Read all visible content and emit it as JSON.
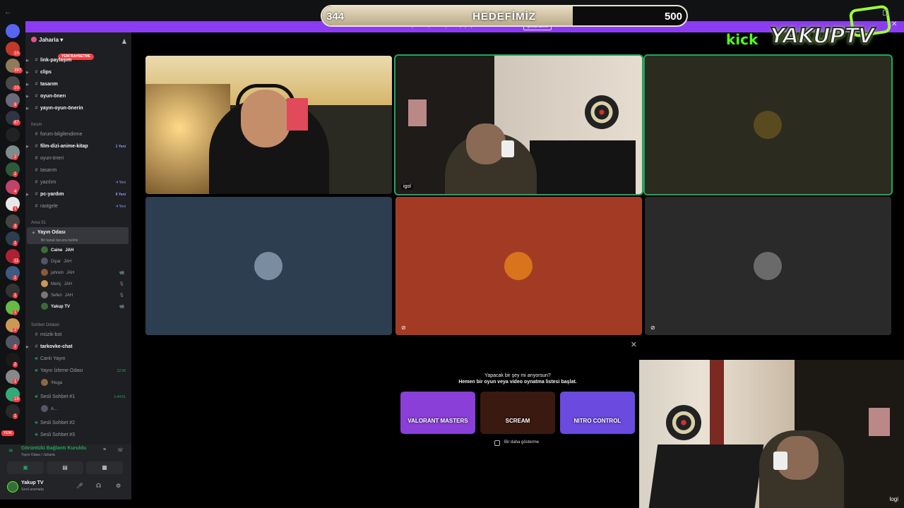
{
  "goal": {
    "current": "344",
    "title": "HEDEFİMİZ",
    "target": "500",
    "progress": 0.688
  },
  "logo": {
    "kick": "kick",
    "name": "YAKUPTV"
  },
  "rail": {
    "avatars": [
      {
        "color": "#5865f2",
        "badge": ""
      },
      {
        "color": "#c0392b",
        "badge": "10"
      },
      {
        "color": "#8e7b5a",
        "badge": "397"
      },
      {
        "color": "#4a4a4a",
        "badge": "10"
      },
      {
        "color": "#6a6a7a",
        "badge": "9"
      },
      {
        "color": "#2f3542",
        "badge": "87"
      },
      {
        "color": "#222",
        "badge": ""
      },
      {
        "color": "#7f8c8d",
        "badge": "2"
      },
      {
        "color": "#2d5a3a",
        "badge": "1"
      },
      {
        "color": "#c0446a",
        "badge": "4"
      },
      {
        "color": "#e8e8e8",
        "badge": "1"
      },
      {
        "color": "#444",
        "badge": "3"
      },
      {
        "color": "#2c3e50",
        "badge": "1"
      },
      {
        "color": "#a23",
        "badge": "11"
      },
      {
        "color": "#3d5a80",
        "badge": "1"
      },
      {
        "color": "#333",
        "badge": "1"
      },
      {
        "color": "#6b4",
        "badge": "1"
      },
      {
        "color": "#c95",
        "badge": "2"
      },
      {
        "color": "#556",
        "badge": "7"
      },
      {
        "color": "#1a1a1a",
        "badge": "2"
      },
      {
        "color": "#888",
        "badge": "1"
      },
      {
        "color": "#3a7",
        "badge": "19"
      },
      {
        "color": "#2a2a2a",
        "badge": "1"
      }
    ],
    "new_label": "YENİ"
  },
  "sidebar": {
    "server": "Jaharia",
    "new_badge": "YENİ BAHSETME",
    "channels_a": [
      {
        "name": "link-paylaşım",
        "bright": true
      },
      {
        "name": "clips",
        "bright": true
      },
      {
        "name": "tasarım",
        "bright": true
      },
      {
        "name": "oyun-önerı",
        "bright": true
      },
      {
        "name": "yayın-oyun-önerin",
        "bright": true
      }
    ],
    "cat_forum": "forum",
    "channels_forum": [
      {
        "name": "forum-bilgilendirme",
        "bright": false,
        "count": ""
      },
      {
        "name": "film-dizi-anime-kitap",
        "bright": true,
        "count": "1 Yeni"
      },
      {
        "name": "oyun-öneri",
        "bright": false,
        "count": ""
      },
      {
        "name": "tasarım",
        "bright": false,
        "count": ""
      },
      {
        "name": "yazılım",
        "bright": false,
        "count": "4 Yeni"
      },
      {
        "name": "pc-yardım",
        "bright": true,
        "count": "9 Yeni"
      },
      {
        "name": "rastgele",
        "bright": false,
        "count": "4 Yeni"
      }
    ],
    "cat_area": "Area 51",
    "voice_channel": "Yayın Odası",
    "voice_sub": "Bir kanal durumu belirle",
    "members": [
      {
        "name": "Caine",
        "tag": "JAH",
        "on": true,
        "color": "#3a6b3a",
        "icon": ""
      },
      {
        "name": "Diyar",
        "tag": "JAH",
        "on": false,
        "color": "#556",
        "icon": ""
      },
      {
        "name": "jahrein",
        "tag": "JAH",
        "on": false,
        "color": "#8a5a3a",
        "icon": "📹"
      },
      {
        "name": "Meriç",
        "tag": "JAH",
        "on": false,
        "color": "#c95",
        "icon": "🎙"
      },
      {
        "name": "Seferi",
        "tag": "JAH",
        "on": false,
        "color": "#777",
        "icon": "🎙"
      },
      {
        "name": "Yakup TV",
        "tag": "",
        "on": true,
        "color": "#3a6b3a",
        "icon": "📹"
      }
    ],
    "cat_sohbet": "Sohbet Odaları",
    "channels_b": [
      {
        "name": "müzik-bot",
        "bright": false,
        "kind": "text",
        "time": ""
      },
      {
        "name": "tarkovke-chat",
        "bright": true,
        "kind": "text",
        "time": ""
      },
      {
        "name": "Canlı Yayın",
        "bright": false,
        "kind": "voice",
        "time": ""
      },
      {
        "name": "Yayın İzleme Odası",
        "bright": false,
        "kind": "voice",
        "time": "12:36"
      }
    ],
    "member_nuga": "!Nuga",
    "channel_sesli1": "Sesli Sohbet #1",
    "time_sesli1": "1:44:51",
    "member_a": "A...",
    "channel_sesli2": "Sesli Sohbet #2",
    "channel_sesli3": "Sesli Sohbet #3"
  },
  "voice": {
    "title": "Görüntülü Bağlantı Kuruldu",
    "sub": "Yayın Odası / Jaharia"
  },
  "user": {
    "name": "Yakup TV",
    "status": "Sesli aramada"
  },
  "banner": {
    "text": "Yayınını ekip arkadaşlarınla paylaşmak ister misin? Hemen dene",
    "button": "Şimdi dene"
  },
  "tiles": [
    {
      "name": "",
      "bg": "#2a2a22",
      "speaking": false,
      "avatar": ""
    },
    {
      "name": "igol",
      "bg": "#1e1b18",
      "speaking": true,
      "avatar": ""
    },
    {
      "name": "",
      "bg": "#2b2b20",
      "speaking": true,
      "avatar": "#5a4a20"
    },
    {
      "name": "",
      "bg": "#2c3e50",
      "speaking": false,
      "avatar": "#7a8da0"
    },
    {
      "name": "",
      "bg": "#a33b24",
      "speaking": false,
      "avatar": "#d9741c"
    },
    {
      "name": "",
      "bg": "#2a2a2a",
      "speaking": false,
      "avatar": "#6a6a6a"
    }
  ],
  "activity": {
    "question": "Yapacak bir şey mi arıyorsun?",
    "subtitle": "Hemen bir oyun veya video oynatma listesi başlat.",
    "cards": [
      {
        "label": "VALORANT MASTERS",
        "bg": "#8a3fd8"
      },
      {
        "label": "SCREAM",
        "bg": "#3a1a10"
      },
      {
        "label": "NITRO CONTROL",
        "bg": "#6b4ae0"
      }
    ],
    "dont_show": "Bir daha gösterme"
  },
  "cam": {
    "watermark": "logi"
  }
}
